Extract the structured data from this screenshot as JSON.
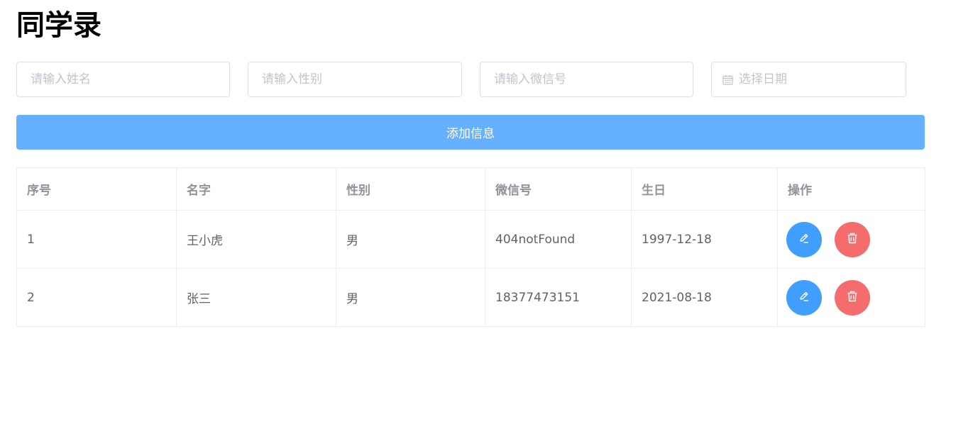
{
  "page": {
    "title": "同学录"
  },
  "form": {
    "name_placeholder": "请输入姓名",
    "gender_placeholder": "请输入性别",
    "wechat_placeholder": "请输入微信号",
    "date_placeholder": "选择日期",
    "date_icon": "calendar-icon",
    "add_label": "添加信息"
  },
  "table": {
    "headers": [
      "序号",
      "名字",
      "性别",
      "微信号",
      "生日",
      "操作"
    ],
    "rows": [
      {
        "index": "1",
        "name": "王小虎",
        "gender": "男",
        "wechat": "404notFound",
        "birthday": "1997-12-18"
      },
      {
        "index": "2",
        "name": "张三",
        "gender": "男",
        "wechat": "18377473151",
        "birthday": "2021-08-18"
      }
    ],
    "edit_icon": "edit-icon",
    "delete_icon": "delete-icon"
  },
  "colors": {
    "primary": "#409eff",
    "primary_light": "#66b1ff",
    "danger": "#f56c6c",
    "border": "#dcdfe6",
    "placeholder": "#c0c4cc",
    "header_text": "#909399",
    "body_text": "#606266"
  }
}
